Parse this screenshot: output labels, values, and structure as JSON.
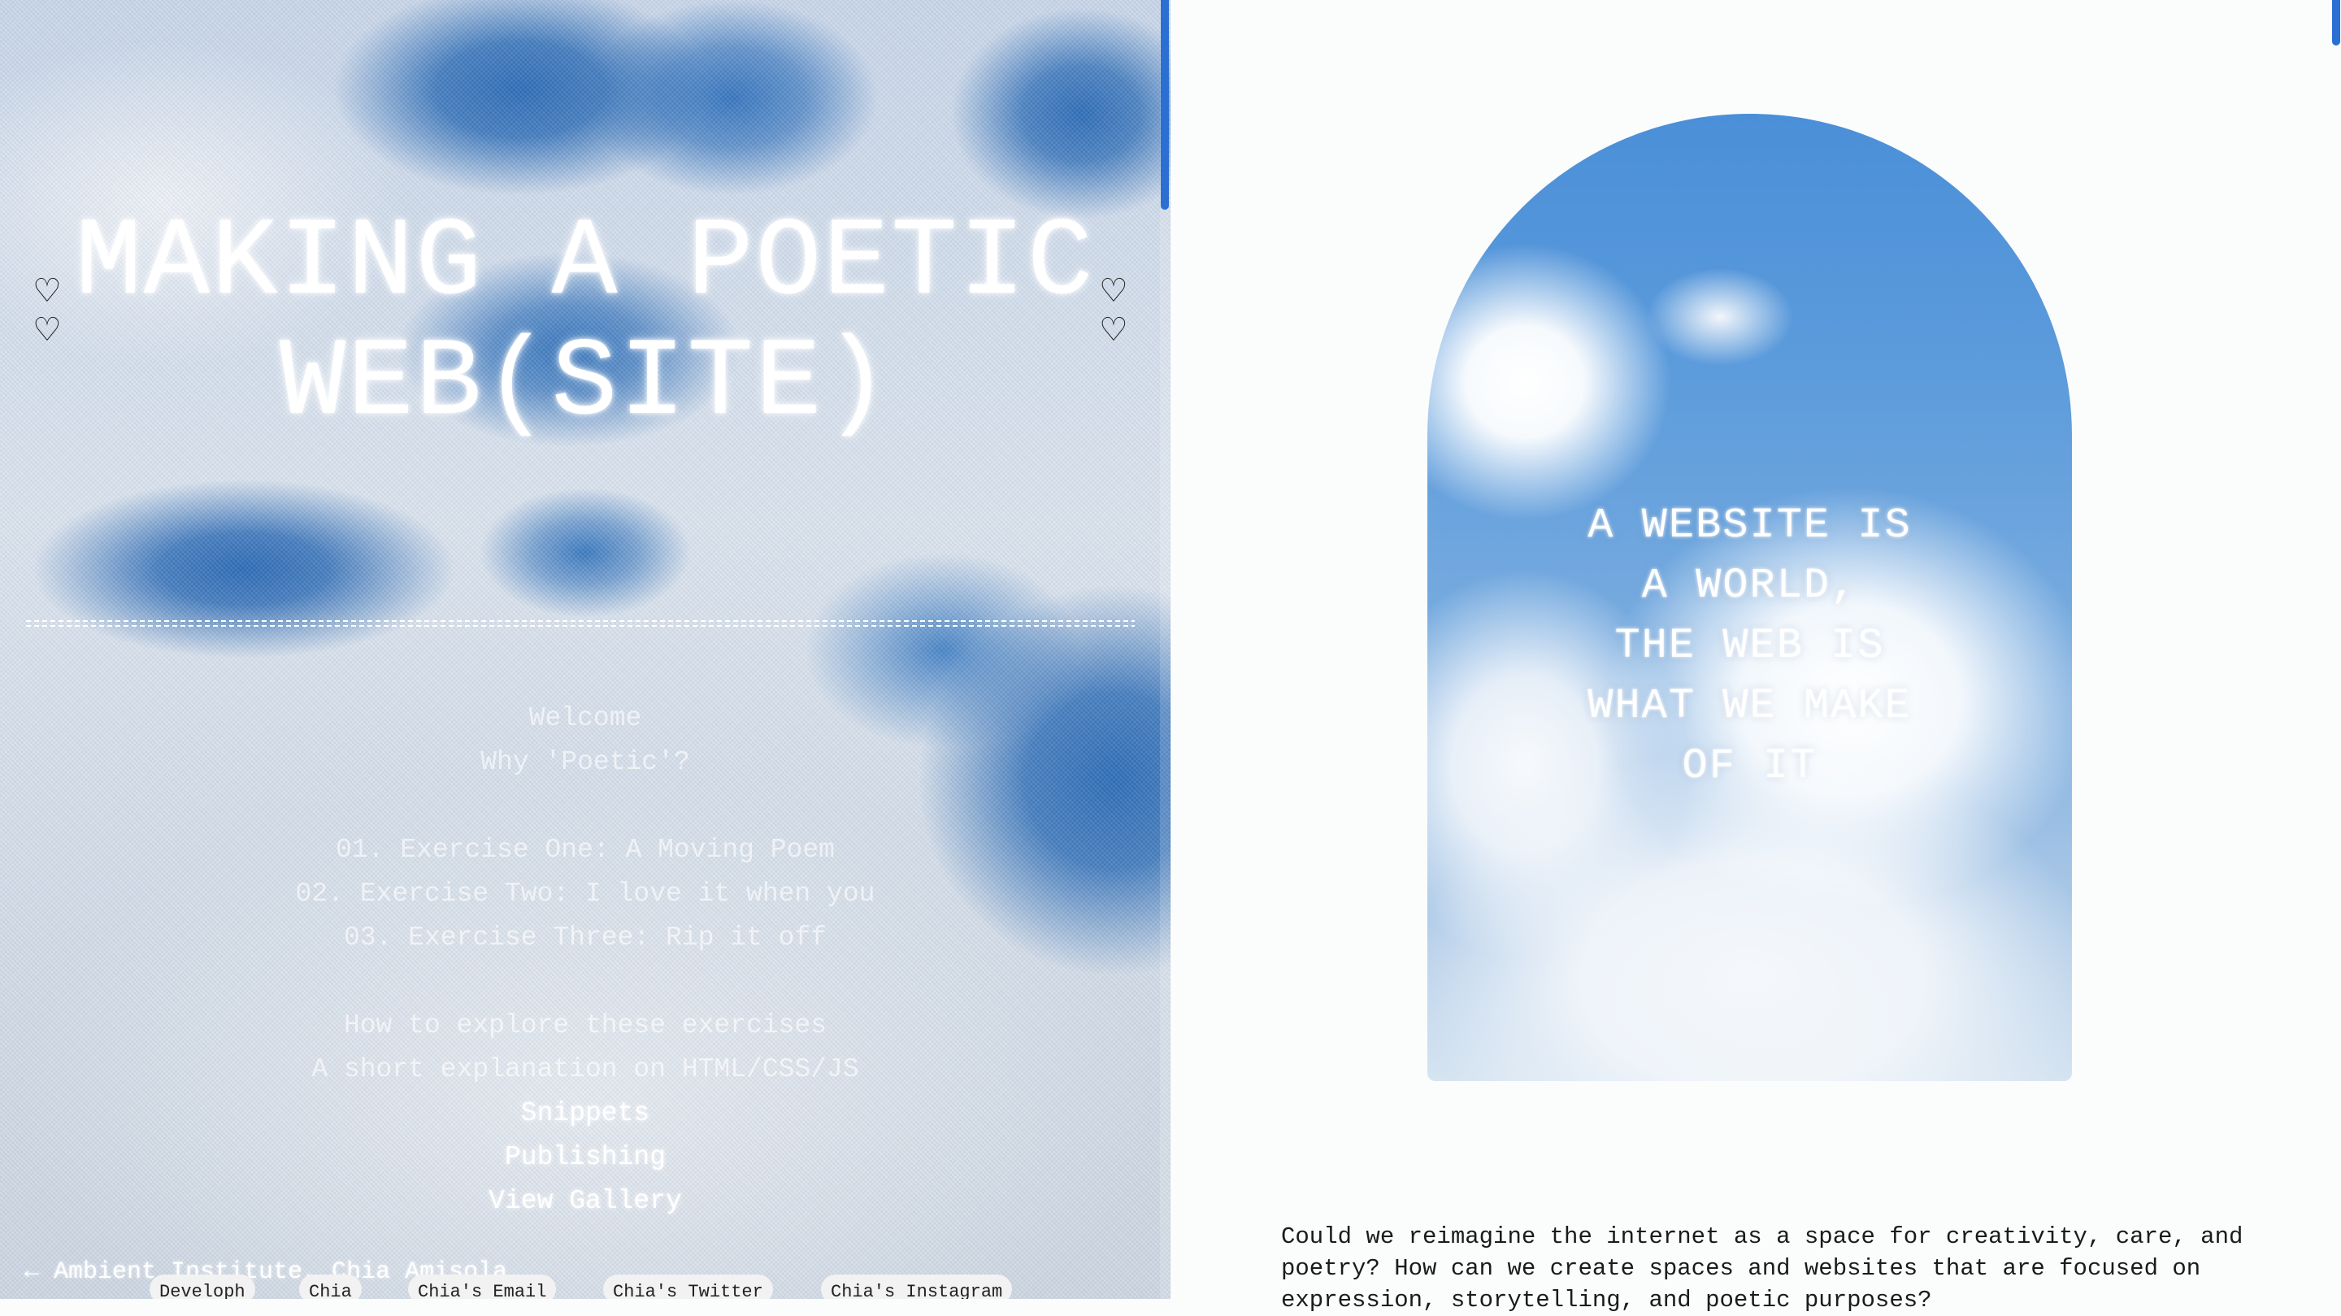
{
  "title": {
    "line1": "MAKING A POETIC",
    "line2": "WEB(SITE)"
  },
  "hearts": {
    "glyph": "♡"
  },
  "menu": {
    "welcome": "Welcome",
    "why_poetic": "Why 'Poetic'?",
    "exercise1": "01. Exercise One: A Moving Poem",
    "exercise2": "02. Exercise Two: I love it when you",
    "exercise3": "03. Exercise Three: Rip it off",
    "how_to": "How to explore these exercises",
    "explanation": "A short explanation on HTML/CSS/JS",
    "snippets": "Snippets",
    "publishing": "Publishing",
    "gallery": "View Gallery"
  },
  "footer": {
    "back_link": "← Ambient Institute, Chia Amisola",
    "chips": [
      "Developh",
      "Chia",
      "Chia's Email",
      "Chia's Twitter",
      "Chia's Instagram"
    ]
  },
  "arch": {
    "lines": [
      "A WEBSITE IS",
      "A WORLD,",
      "THE WEB IS",
      "WHAT WE MAKE",
      "OF IT"
    ]
  },
  "intro": {
    "text": "Could we reimagine the internet as a space for creativity, care, and poetry? How can we create spaces and websites that are focused on expression, storytelling, and poetic purposes?"
  },
  "colors": {
    "accent_blue": "#2a6fd1",
    "sky_blue": "#2f6fb9",
    "page_bg": "#fbfcfc",
    "text_dark": "#1b1b1b"
  }
}
